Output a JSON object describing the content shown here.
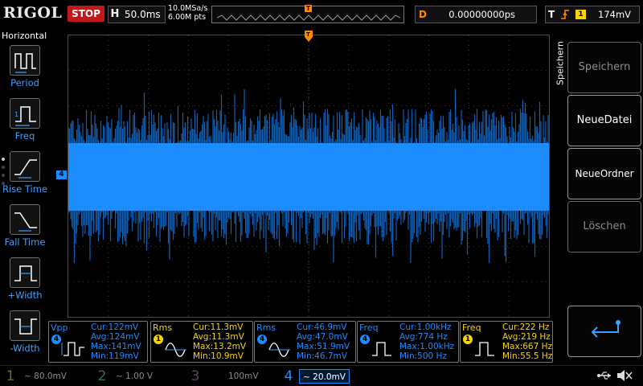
{
  "brand": "RIGOL",
  "run_state": "STOP",
  "timebase": {
    "label": "H",
    "value": "50.0ms"
  },
  "acquisition": {
    "sample_rate": "10.0MSa/s",
    "memory": "6.00M pts"
  },
  "trigger_position_marker": "T",
  "delay": {
    "label": "D",
    "value": "0.00000000ps"
  },
  "trigger": {
    "label": "T",
    "source": "1",
    "level": "174mV"
  },
  "left_menu": {
    "title": "Horizontal",
    "items": [
      {
        "label": "Period"
      },
      {
        "label": "Freq"
      },
      {
        "label": "Rise Time"
      },
      {
        "label": "Fall Time"
      },
      {
        "label": "+Width"
      },
      {
        "label": "-Width"
      }
    ]
  },
  "right_menu": {
    "tab": "Speichern",
    "buttons": [
      {
        "label": "Speichern",
        "state": "disabled"
      },
      {
        "label": "NeueDatei",
        "state": "enabled"
      },
      {
        "label": "NeueOrdner",
        "state": "enabled"
      },
      {
        "label": "Löschen",
        "state": "disabled"
      },
      {
        "label": "",
        "icon": "return-arrow-icon"
      }
    ]
  },
  "channel_marker": "4",
  "measurements": [
    {
      "name": "Vpp",
      "channel": "4",
      "color": "#1c8cff",
      "cur": "Cur:122mV",
      "avg": "Avg:124mV",
      "max": "Max:141mV",
      "min": "Min:119mV"
    },
    {
      "name": "Rms",
      "channel": "1",
      "color": "#f5d400",
      "cur": "Cur:11.3mV",
      "avg": "Avg:11.3mV",
      "max": "Max:13.2mV",
      "min": "Min:10.9mV"
    },
    {
      "name": "Rms",
      "channel": "4",
      "color": "#1c8cff",
      "cur": "Cur:46.9mV",
      "avg": "Avg:47.0mV",
      "max": "Max:51.9mV",
      "min": "Min:46.7mV"
    },
    {
      "name": "Freq",
      "channel": "4",
      "color": "#1c8cff",
      "cur": "Cur:1.00kHz",
      "avg": "Avg:774 Hz",
      "max": "Max:1.00kHz",
      "min": "Min:500 Hz"
    },
    {
      "name": "Freq",
      "channel": "1",
      "color": "#f5d400",
      "cur": "Cur:222 Hz",
      "avg": "Avg:219 Hz",
      "max": "Max:667 Hz",
      "min": "Min:55.5 Hz"
    }
  ],
  "channels": [
    {
      "num": "1",
      "value": "~ 80.0mV",
      "color": "#6f6a1c"
    },
    {
      "num": "2",
      "value": "~  1.00 V",
      "color": "#3a6a4a"
    },
    {
      "num": "3",
      "value": "100mV",
      "color": "#6a3a66"
    },
    {
      "num": "4",
      "value": "~ 20.0mV",
      "color": "#1c8cff"
    }
  ]
}
